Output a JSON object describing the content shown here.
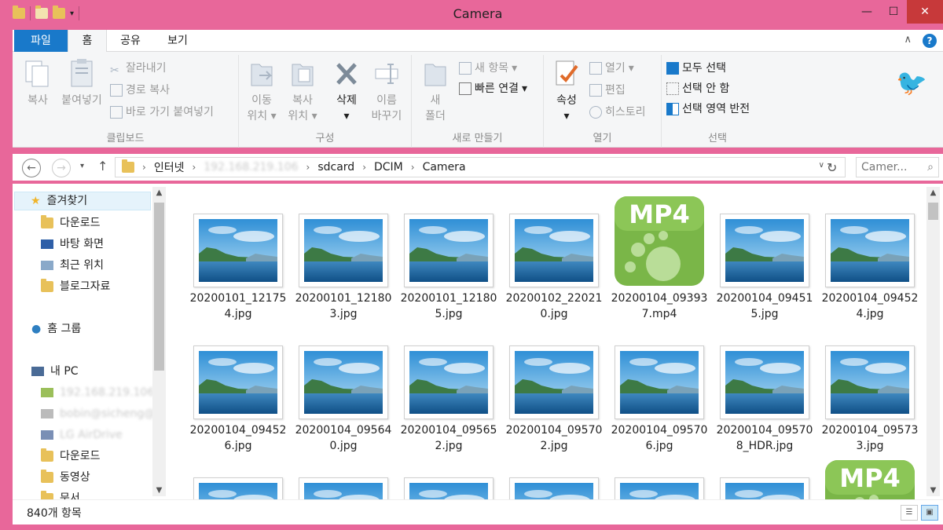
{
  "window": {
    "title": "Camera"
  },
  "menu": {
    "tabs": [
      {
        "label": "파일"
      },
      {
        "label": "홈"
      },
      {
        "label": "공유"
      },
      {
        "label": "보기"
      }
    ]
  },
  "ribbon": {
    "clipboard": {
      "group_label": "클립보드",
      "copy": "복사",
      "paste": "붙여넣기",
      "cut": "잘라내기",
      "copy_path": "경로 복사",
      "paste_shortcut": "바로 가기 붙여넣기"
    },
    "organize": {
      "group_label": "구성",
      "move_to_1": "이동",
      "move_to_2": "위치",
      "copy_to_1": "복사",
      "copy_to_2": "위치",
      "delete": "삭제",
      "rename_1": "이름",
      "rename_2": "바꾸기"
    },
    "new": {
      "group_label": "새로 만들기",
      "new_folder_1": "새",
      "new_folder_2": "폴더",
      "new_item": "새 항목",
      "easy_access": "빠른 연결"
    },
    "open": {
      "group_label": "열기",
      "properties": "속성",
      "open": "열기",
      "edit": "편집",
      "history": "히스토리"
    },
    "select": {
      "group_label": "선택",
      "select_all": "모두 선택",
      "select_none": "선택 안 함",
      "invert": "선택 영역 반전"
    }
  },
  "address": {
    "crumbs": [
      "인터넷",
      "192.168.219.106",
      "sdcard",
      "DCIM",
      "Camera"
    ],
    "search_placeholder": "Camer..."
  },
  "nav": {
    "favorites": "즐겨찾기",
    "fav_items": [
      "다운로드",
      "바탕 화면",
      "최근 위치",
      "블로그자료"
    ],
    "homegroup": "홈 그룹",
    "pc": "내 PC",
    "pc_items": [
      "192.168.219.106",
      "bobin@sicheng@1",
      "LG AirDrive",
      "다운로드",
      "동영상",
      "문서"
    ]
  },
  "files": [
    {
      "l1": "20200101_12175",
      "l2": "4.jpg",
      "type": "jpg"
    },
    {
      "l1": "20200101_12180",
      "l2": "3.jpg",
      "type": "jpg"
    },
    {
      "l1": "20200101_12180",
      "l2": "5.jpg",
      "type": "jpg"
    },
    {
      "l1": "20200102_22021",
      "l2": "0.jpg",
      "type": "jpg"
    },
    {
      "l1": "20200104_09393",
      "l2": "7.mp4",
      "type": "mp4"
    },
    {
      "l1": "20200104_09451",
      "l2": "5.jpg",
      "type": "jpg"
    },
    {
      "l1": "20200104_09452",
      "l2": "4.jpg",
      "type": "jpg"
    },
    {
      "l1": "20200104_09452",
      "l2": "6.jpg",
      "type": "jpg"
    },
    {
      "l1": "20200104_09564",
      "l2": "0.jpg",
      "type": "jpg"
    },
    {
      "l1": "20200104_09565",
      "l2": "2.jpg",
      "type": "jpg"
    },
    {
      "l1": "20200104_09570",
      "l2": "2.jpg",
      "type": "jpg"
    },
    {
      "l1": "20200104_09570",
      "l2": "6.jpg",
      "type": "jpg"
    },
    {
      "l1": "20200104_09570",
      "l2": "8_HDR.jpg",
      "type": "jpg"
    },
    {
      "l1": "20200104_09573",
      "l2": "3.jpg",
      "type": "jpg"
    }
  ],
  "partial_row": [
    "jpg",
    "jpg",
    "jpg",
    "jpg",
    "jpg",
    "jpg",
    "mp4"
  ],
  "mp4_label": "MP4",
  "status": {
    "count": "840개 항목"
  },
  "colors": {
    "accent": "#1979ca",
    "frame": "#e8679a",
    "close": "#c7393a",
    "mp4_green": "#7ab648"
  }
}
